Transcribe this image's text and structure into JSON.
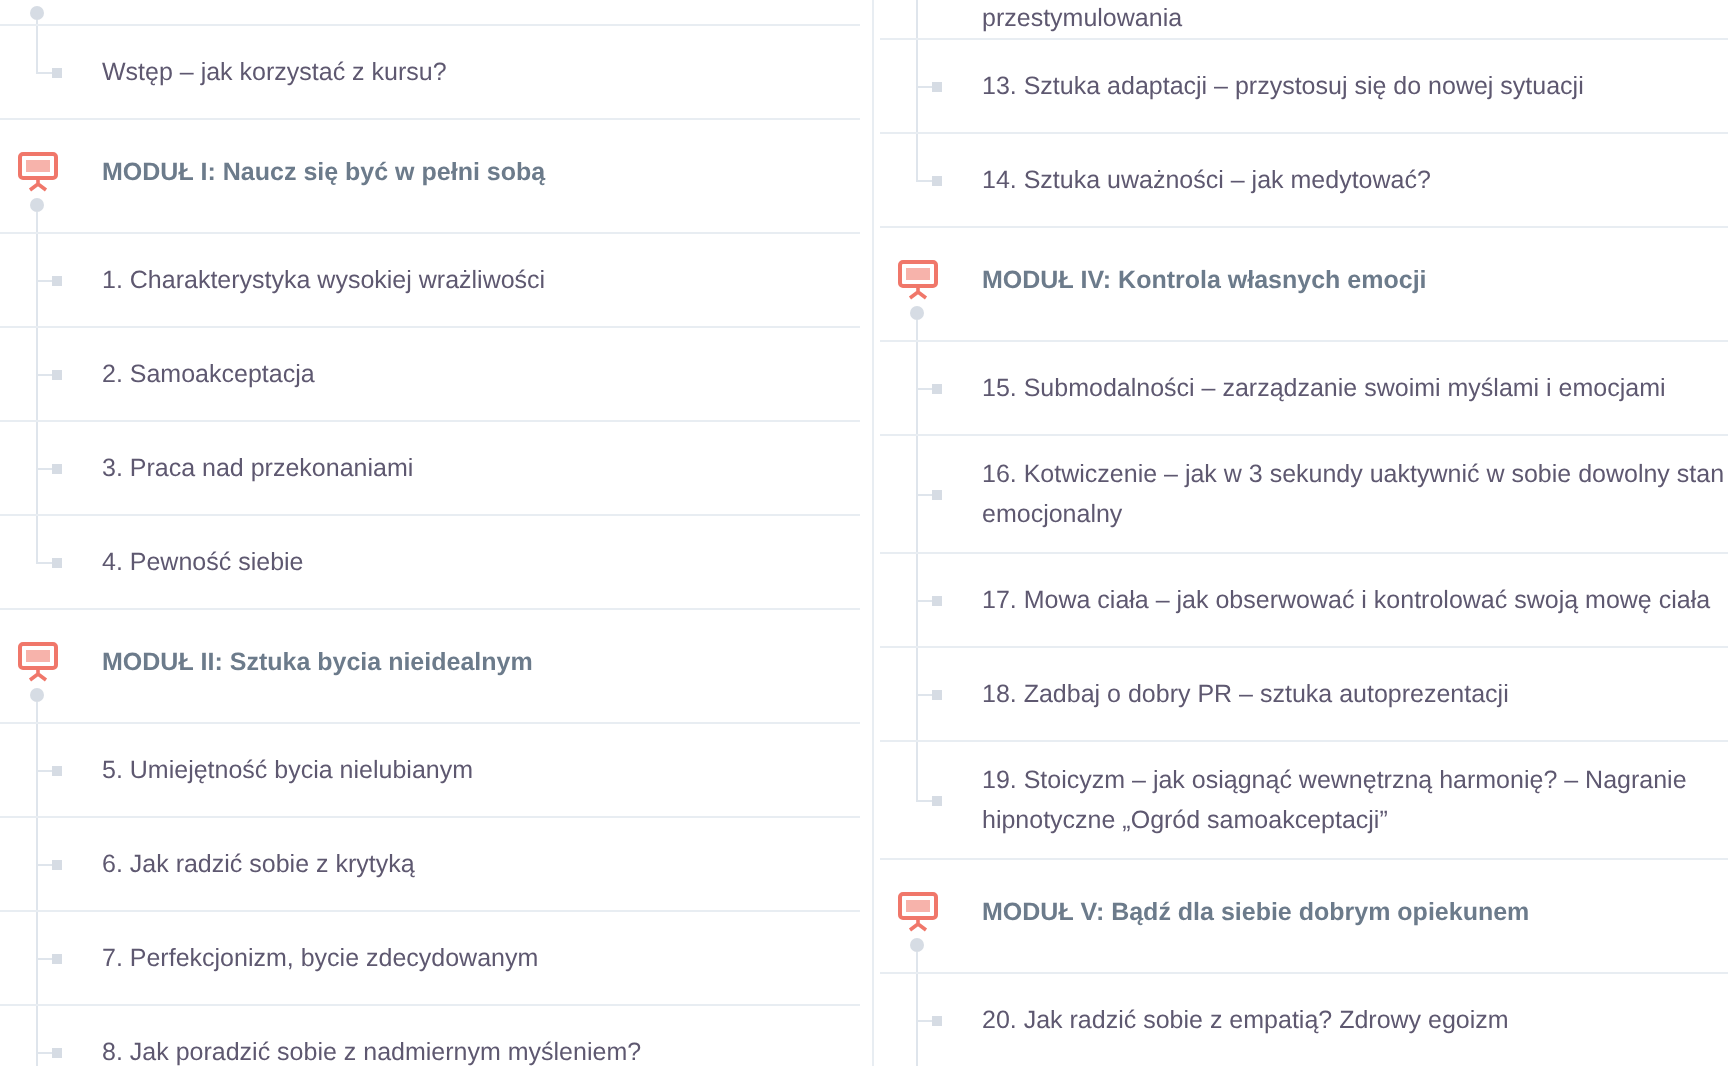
{
  "columns": [
    {
      "rows": [
        {
          "kind": "top"
        },
        {
          "kind": "lesson",
          "title": "Wstęp – jak korzystać z kursu?",
          "last": true
        },
        {
          "kind": "module",
          "title": "MODUŁ I: Naucz się być w pełni sobą"
        },
        {
          "kind": "lesson",
          "title": "1. Charakterystyka wysokiej wrażliwości",
          "last": false
        },
        {
          "kind": "lesson",
          "title": "2. Samoakceptacja",
          "last": false
        },
        {
          "kind": "lesson",
          "title": "3. Praca nad przekonaniami",
          "last": false
        },
        {
          "kind": "lesson",
          "title": "4. Pewność siebie",
          "last": true
        },
        {
          "kind": "module",
          "title": "MODUŁ II: Sztuka bycia nieidealnym"
        },
        {
          "kind": "lesson",
          "title": "5. Umiejętność bycia nielubianym",
          "last": false
        },
        {
          "kind": "lesson",
          "title": "6. Jak radzić sobie z krytyką",
          "last": false
        },
        {
          "kind": "lesson",
          "title": "7. Perfekcjonizm, bycie zdecydowanym",
          "last": false
        },
        {
          "kind": "lesson",
          "title": "8. Jak poradzić sobie z nadmiernym myśleniem?",
          "last": false
        }
      ]
    },
    {
      "rows": [
        {
          "kind": "continuation",
          "title": "przestymulowania"
        },
        {
          "kind": "lesson",
          "title": "13. Sztuka adaptacji – przystosuj się do nowej sytuacji",
          "last": false
        },
        {
          "kind": "lesson",
          "title": "14. Sztuka uważności – jak medytować?",
          "last": true
        },
        {
          "kind": "module",
          "title": "MODUŁ IV: Kontrola własnych emocji"
        },
        {
          "kind": "lesson",
          "title": "15. Submodalności – zarządzanie swoimi myślami i emocjami",
          "last": false
        },
        {
          "kind": "lesson",
          "title": "16. Kotwiczenie – jak w 3 sekundy uaktywnić w sobie dowolny stan emocjonalny",
          "last": false
        },
        {
          "kind": "lesson",
          "title": "17. Mowa ciała – jak obserwować i kontrolować swoją mowę ciała",
          "last": false
        },
        {
          "kind": "lesson",
          "title": "18. Zadbaj o dobry PR – sztuka autoprezentacji",
          "last": false
        },
        {
          "kind": "lesson",
          "title": "19. Stoicyzm – jak osiągnąć wewnętrzną harmonię? – Nagranie hipnotyczne „Ogród samoakceptacji”",
          "last": true
        },
        {
          "kind": "module",
          "title": "MODUŁ V: Bądź dla siebie dobrym opiekunem"
        },
        {
          "kind": "lesson",
          "title": "20. Jak radzić sobie z empatią? Zdrowy egoizm",
          "last": false
        }
      ]
    }
  ]
}
